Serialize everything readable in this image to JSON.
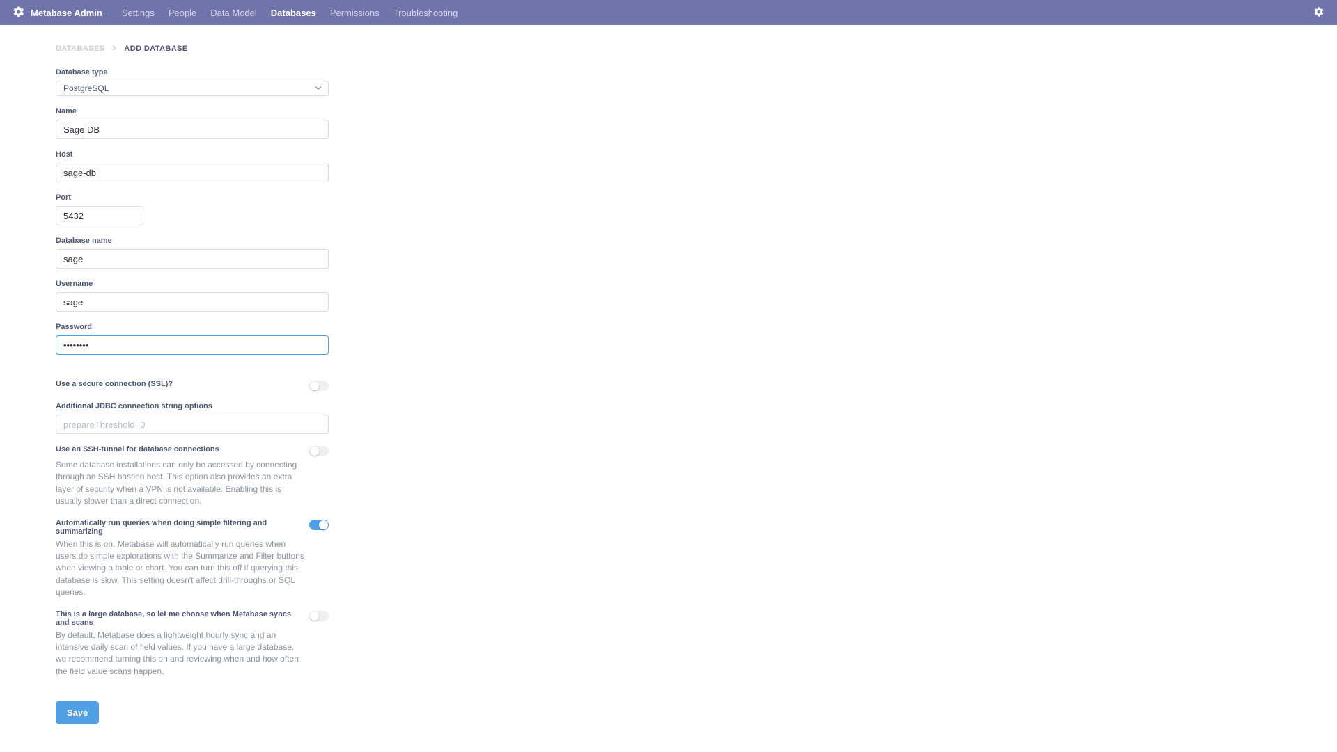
{
  "header": {
    "brand": "Metabase Admin",
    "nav": [
      {
        "label": "Settings",
        "active": false
      },
      {
        "label": "People",
        "active": false
      },
      {
        "label": "Data Model",
        "active": false
      },
      {
        "label": "Databases",
        "active": true
      },
      {
        "label": "Permissions",
        "active": false
      },
      {
        "label": "Troubleshooting",
        "active": false
      }
    ]
  },
  "breadcrumb": {
    "parent": "DATABASES",
    "current": "ADD DATABASE"
  },
  "form": {
    "db_type": {
      "label": "Database type",
      "value": "PostgreSQL"
    },
    "name": {
      "label": "Name",
      "value": "Sage DB"
    },
    "host": {
      "label": "Host",
      "value": "sage-db"
    },
    "port": {
      "label": "Port",
      "value": "5432"
    },
    "dbname": {
      "label": "Database name",
      "value": "sage"
    },
    "username": {
      "label": "Username",
      "value": "sage"
    },
    "password": {
      "label": "Password",
      "value": "••••••••"
    },
    "ssl": {
      "label": "Use a secure connection (SSL)?",
      "on": false
    },
    "jdbc": {
      "label": "Additional JDBC connection string options",
      "placeholder": "prepareThreshold=0",
      "value": ""
    },
    "ssh": {
      "label": "Use an SSH-tunnel for database connections",
      "desc": "Some database installations can only be accessed by connecting through an SSH bastion host. This option also provides an extra layer of security when a VPN is not available. Enabling this is usually slower than a direct connection.",
      "on": false
    },
    "autorun": {
      "label": "Automatically run queries when doing simple filtering and summarizing",
      "desc": "When this is on, Metabase will automatically run queries when users do simple explorations with the Summarize and Filter buttons when viewing a table or chart. You can turn this off if querying this database is slow. This setting doesn't affect drill-throughs or SQL queries.",
      "on": true
    },
    "large": {
      "label": "This is a large database, so let me choose when Metabase syncs and scans",
      "desc": "By default, Metabase does a lightweight hourly sync and an intensive daily scan of field values. If you have a large database, we recommend turning this on and reviewing when and how often the field value scans happen.",
      "on": false
    },
    "save_label": "Save"
  }
}
